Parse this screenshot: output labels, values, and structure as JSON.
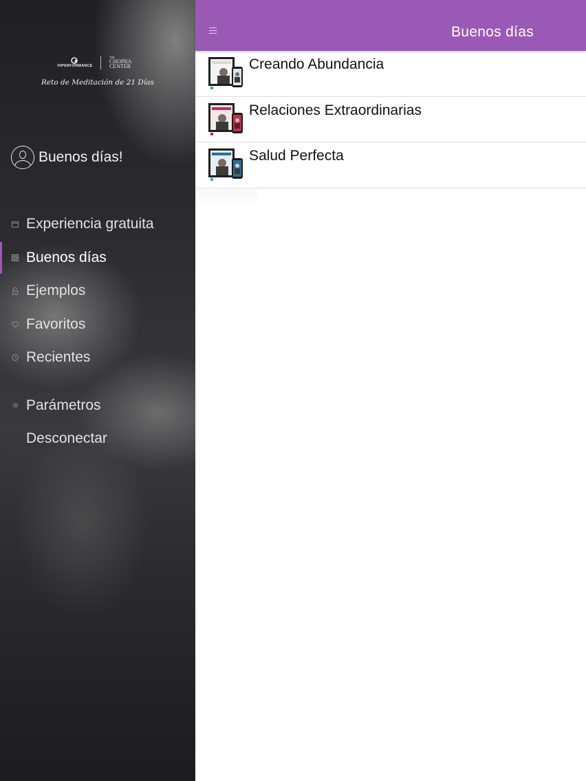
{
  "sidebar": {
    "brand": {
      "left_wordmark": "HIPERFORMANCE",
      "right_the": "THE",
      "right_line1": "CHOPRA",
      "right_line2": "CENTER",
      "tagline": "Reto de Meditación de 21 Días"
    },
    "profile": {
      "icon": "user-circle-icon",
      "name": "Buenos días!"
    },
    "items": [
      {
        "label": "Experiencia gratuita",
        "icon": "calendar-icon",
        "active": false
      },
      {
        "label": "Buenos días",
        "icon": "grid-icon",
        "active": true
      },
      {
        "label": "Ejemplos",
        "icon": "lock-open-icon",
        "active": false
      },
      {
        "label": "Favoritos",
        "icon": "heart-icon",
        "active": false
      },
      {
        "label": "Recientes",
        "icon": "clock-icon",
        "active": false
      }
    ],
    "secondary_items": [
      {
        "label": "Parámetros",
        "icon": "gear-icon"
      },
      {
        "label": "Desconectar",
        "icon": ""
      }
    ],
    "accent_color": "#9b59b6"
  },
  "header": {
    "menu_icon": "hamburger-icon",
    "title": "Buenos días",
    "color": "#9b59b6"
  },
  "content": {
    "rows": [
      {
        "title": "Creando Abundancia",
        "accent": "#3aa0d8"
      },
      {
        "title": "Relaciones Extraordinarias",
        "accent": "#c0304a"
      },
      {
        "title": "Salud Perfecta",
        "accent": "#3aa0d8"
      }
    ]
  }
}
